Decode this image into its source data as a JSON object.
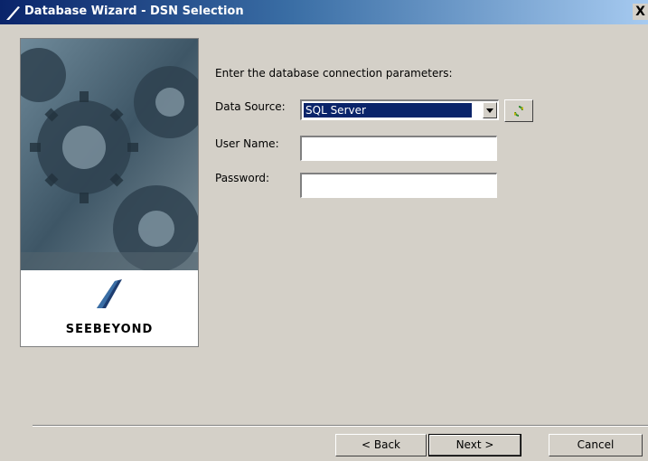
{
  "window": {
    "title": "Database Wizard - DSN Selection",
    "close_glyph": "X"
  },
  "side_panel": {
    "brand": "SeeBeyond",
    "brand_display": "SEEBEYOND"
  },
  "form": {
    "instruction": "Enter the database connection parameters:",
    "data_source_label": "Data Source:",
    "data_source_value": "SQL Server",
    "user_name_label": "User Name:",
    "user_name_value": "",
    "password_label": "Password:",
    "password_value": ""
  },
  "buttons": {
    "back": "< Back",
    "next": "Next >",
    "cancel": "Cancel"
  },
  "icons": {
    "title_logo": "seebeyond-logo-icon",
    "refresh": "refresh-icon",
    "dropdown": "chevron-down-icon"
  }
}
